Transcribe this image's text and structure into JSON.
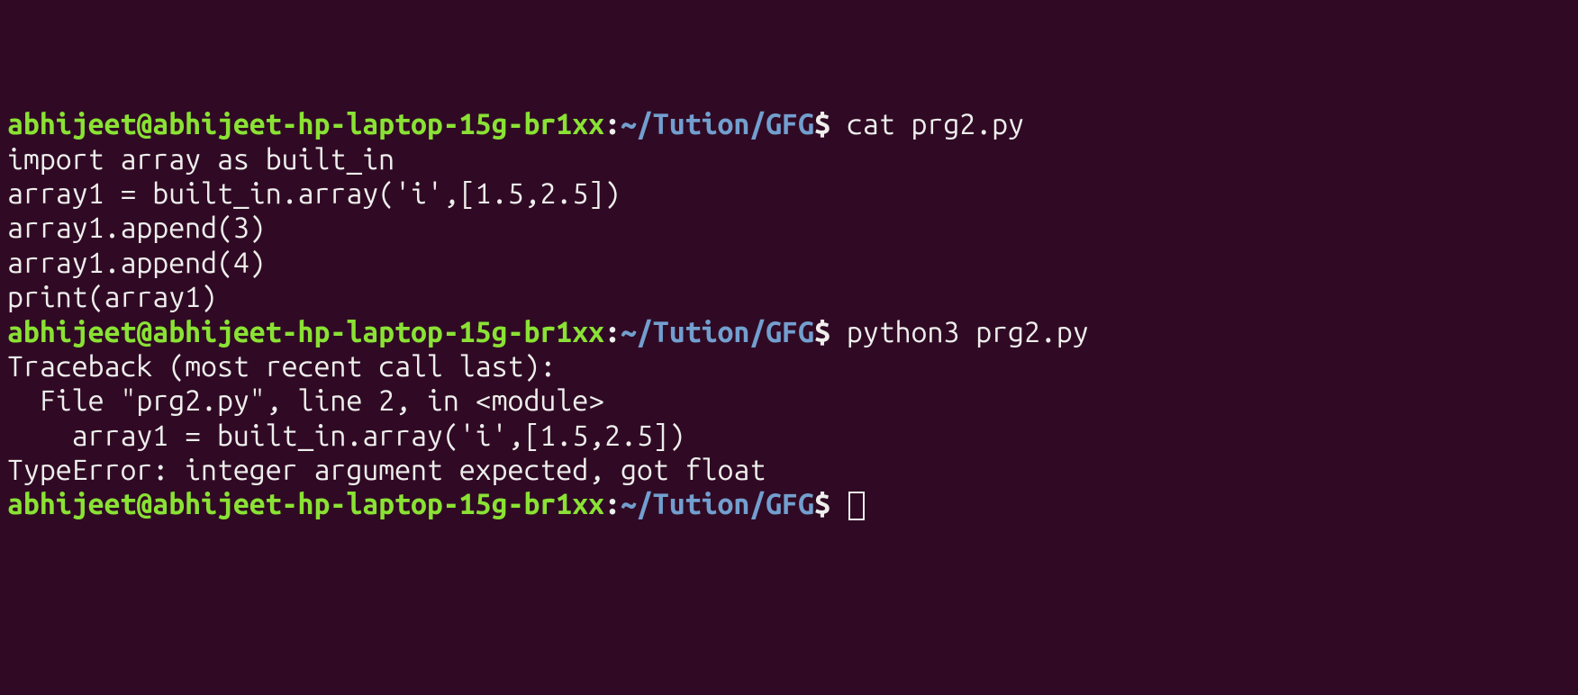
{
  "prompt": {
    "user_host": "abhijeet@abhijeet-hp-laptop-15g-br1xx",
    "separator": ":",
    "path": "~/Tution/GFG",
    "symbol": "$"
  },
  "lines": [
    {
      "type": "prompt",
      "command": "cat prg2.py"
    },
    {
      "type": "output",
      "text": "import array as built_in"
    },
    {
      "type": "output",
      "text": "array1 = built_in.array('i',[1.5,2.5])"
    },
    {
      "type": "output",
      "text": "array1.append(3)"
    },
    {
      "type": "output",
      "text": "array1.append(4)"
    },
    {
      "type": "output",
      "text": "print(array1)"
    },
    {
      "type": "prompt",
      "command": "python3 prg2.py"
    },
    {
      "type": "output",
      "text": "Traceback (most recent call last):"
    },
    {
      "type": "output",
      "text": "  File \"prg2.py\", line 2, in <module>"
    },
    {
      "type": "output",
      "text": "    array1 = built_in.array('i',[1.5,2.5])"
    },
    {
      "type": "output",
      "text": "TypeError: integer argument expected, got float"
    },
    {
      "type": "prompt",
      "command": "",
      "cursor": true
    }
  ]
}
